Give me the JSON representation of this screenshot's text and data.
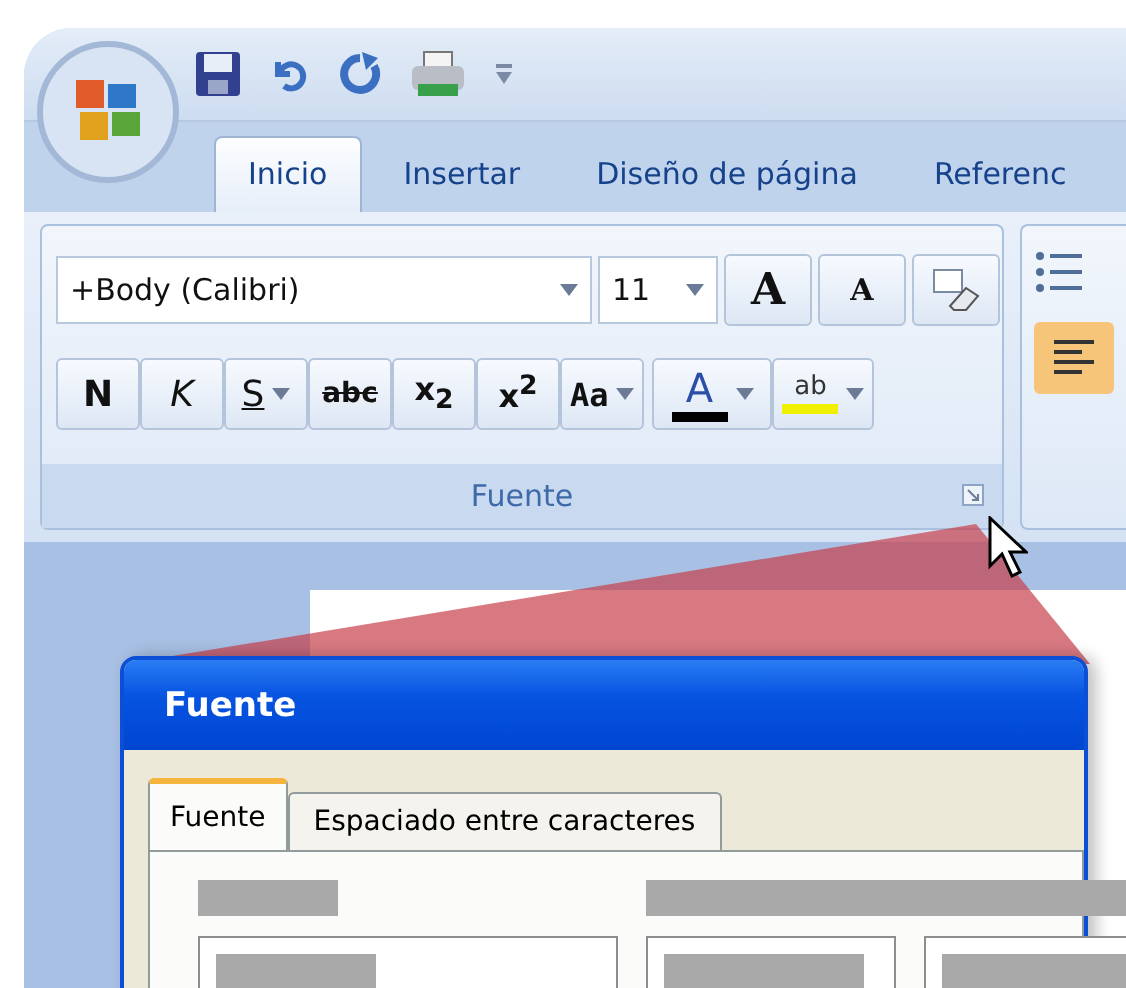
{
  "ribbon_tabs": [
    {
      "label": "Inicio",
      "selected": true
    },
    {
      "label": "Insertar",
      "selected": false
    },
    {
      "label": "Diseño de página",
      "selected": false
    },
    {
      "label": "Referenc",
      "selected": false
    }
  ],
  "font_group": {
    "font_name": "+Body (Calibri)",
    "font_size": "11",
    "grow_label": "A",
    "shrink_label": "A",
    "label": "Fuente",
    "format_buttons": [
      {
        "kind": "bold",
        "label": "N",
        "dropdown": false
      },
      {
        "kind": "italic",
        "label": "K",
        "dropdown": false
      },
      {
        "kind": "underline",
        "label": "S",
        "dropdown": true
      },
      {
        "kind": "strike",
        "label": "abc",
        "dropdown": false
      },
      {
        "kind": "script",
        "label": "x$_{2}$",
        "dropdown": false
      },
      {
        "kind": "script",
        "label": "x$^{2}$",
        "dropdown": false
      },
      {
        "kind": "case",
        "label": "Aa",
        "dropdown": true
      },
      {
        "kind": "color",
        "label": "A",
        "dropdown": true,
        "color": "#000000"
      },
      {
        "kind": "highlight",
        "label": "ab",
        "dropdown": true,
        "color": "#f0f000"
      }
    ]
  },
  "dialog": {
    "title": "Fuente",
    "tabs": [
      {
        "label": "Fuente",
        "selected": true
      },
      {
        "label": "Espaciado entre caracteres",
        "selected": false
      }
    ]
  }
}
